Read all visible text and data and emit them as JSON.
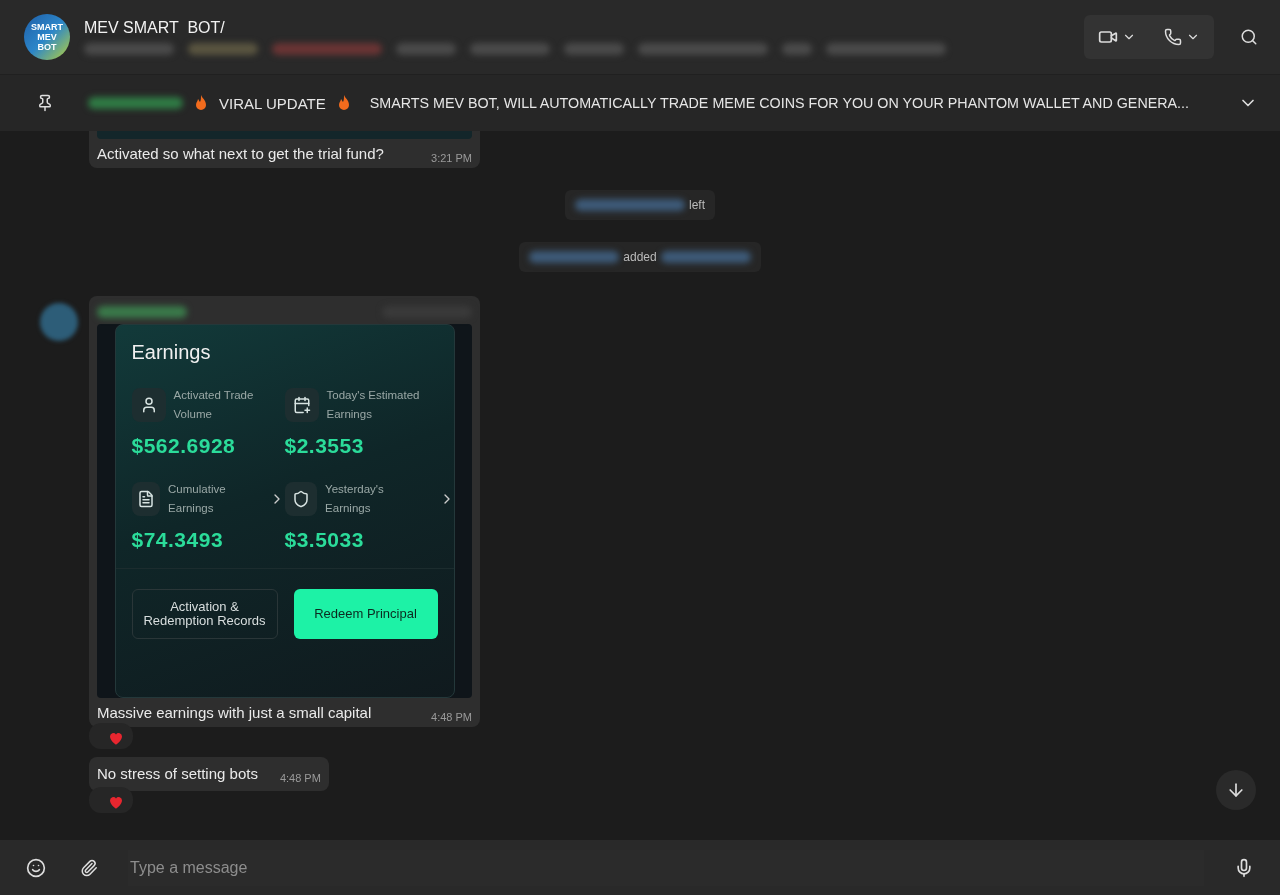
{
  "header": {
    "title": "MEV SMART  BOT/",
    "logo": [
      "SMART",
      "MEV",
      "BOT"
    ]
  },
  "pinned": {
    "headline": "VIRAL UPDATE",
    "text": "SMARTS MEV BOT, WILL AUTOMATICALLY TRADE MEME COINS FOR YOU ON YOUR PHANTOM WALLET AND GENERA..."
  },
  "messages": [
    {
      "kind": "image-text",
      "text": "Activated so what next to get the trial fund?",
      "time": "3:21 PM"
    },
    {
      "kind": "left",
      "text": "left"
    },
    {
      "kind": "added",
      "text": "added"
    },
    {
      "kind": "earnings",
      "card": {
        "title": "Earnings",
        "stats": [
          {
            "label": "Activated Trade Volume",
            "value": "$562.6928",
            "chevron": false
          },
          {
            "label": "Today's Estimated Earnings",
            "value": "$2.3553",
            "chevron": false
          },
          {
            "label": "Cumulative Earnings",
            "value": "$74.3493",
            "chevron": true
          },
          {
            "label": "Yesterday's Earnings",
            "value": "$3.5033",
            "chevron": true
          }
        ],
        "buttons": [
          {
            "kind": "outline",
            "label": "Activation & Redemption Records"
          },
          {
            "kind": "primary",
            "label": "Redeem Principal"
          }
        ]
      },
      "text": "Massive earnings with just a small capital",
      "time": "4:48 PM",
      "reaction": true
    },
    {
      "kind": "text",
      "text": "No stress of setting bots",
      "time": "4:48 PM",
      "reaction": true
    }
  ],
  "composer": {
    "placeholder": "Type a message"
  }
}
